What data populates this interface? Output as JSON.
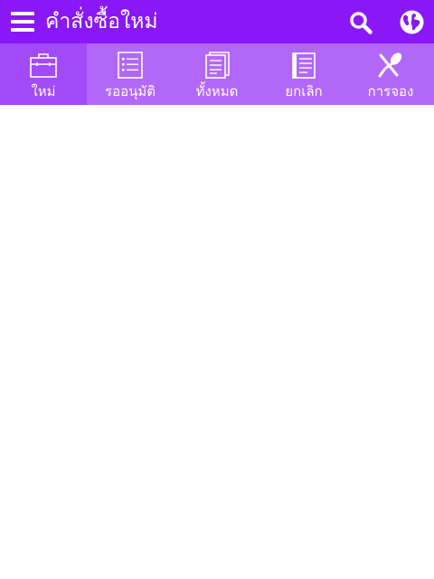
{
  "app_bar": {
    "title": "คำสั่งซื้อใหม่",
    "background": "#8a17f5",
    "menu_icon": "hamburger-menu-icon",
    "search_icon": "search-icon",
    "language_icon": "globe-icon"
  },
  "tabs": {
    "background": "#b168f9",
    "active_background": "#a24af8",
    "items": [
      {
        "label": "ใหม่",
        "icon": "briefcase-icon",
        "active": true
      },
      {
        "label": "รออนุมัติ",
        "icon": "checklist-icon",
        "active": false
      },
      {
        "label": "ทั้งหมด",
        "icon": "documents-icon",
        "active": false
      },
      {
        "label": "ยกเลิก",
        "icon": "notebook-icon",
        "active": false
      },
      {
        "label": "การจอง",
        "icon": "utensils-icon",
        "active": false
      }
    ]
  }
}
